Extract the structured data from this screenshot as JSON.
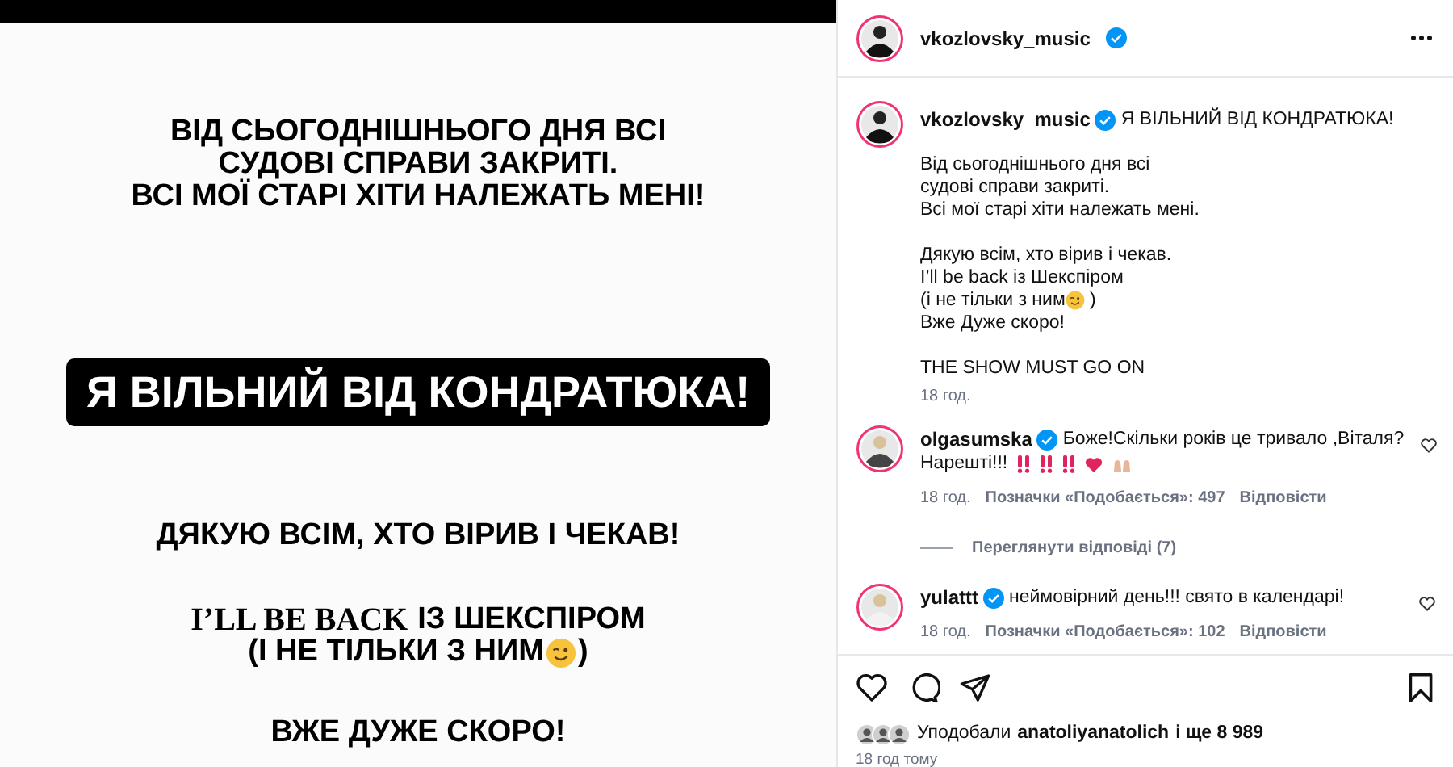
{
  "post_image": {
    "blocks": [
      {
        "kind": "text",
        "lines": [
          {
            "text": "ВІД СЬОГОДНІШНЬОГО ДНЯ ВСІ"
          },
          {
            "text": "СУДОВІ СПРАВИ ЗАКРИТІ."
          },
          {
            "text": "ВСІ МОЇ СТАРІ ХІТИ НАЛЕЖАТЬ МЕНІ!"
          }
        ]
      },
      {
        "kind": "banner",
        "lines": [
          {
            "text": "Я ВІЛЬНИЙ ВІД КОНДРАТЮКА!"
          }
        ]
      },
      {
        "kind": "text",
        "lines": [
          {
            "text": "ДЯКУЮ ВСІМ, ХТО ВІРИВ І ЧЕКАВ!"
          }
        ]
      },
      {
        "kind": "text",
        "lines": [
          {
            "serif": "I’LL BE BACK",
            "text": "ІЗ ШЕКСПІРОМ"
          },
          {
            "text": "(І НЕ ТІЛЬКИ З НИМ",
            "wink": true,
            "tail": ")"
          }
        ]
      },
      {
        "kind": "text",
        "lines": [
          {
            "text": "ВЖЕ ДУЖЕ СКОРО!"
          }
        ]
      }
    ]
  },
  "header": {
    "username": "vkozlovsky_music",
    "verified": true
  },
  "caption": {
    "username": "vkozlovsky_music",
    "verified": true,
    "title": "Я ВІЛЬНИЙ ВІД КОНДРАТЮКА!",
    "paragraphs": [
      [
        {
          "text": "Від сьогоднішнього дня всі"
        },
        {
          "text": "судові справи закриті."
        },
        {
          "text": "Всі мої старі хіти належать мені."
        }
      ],
      [
        {
          "text": "Дякую всім, хто вірив і чекав."
        },
        {
          "text": "I’ll be back із Шекспіром"
        },
        {
          "text": "(і не тільки з ним",
          "wink": true,
          "tail": " )"
        },
        {
          "text": "Вже Дуже скоро!"
        }
      ],
      [
        {
          "text": "THE SHOW MUST GO ON"
        }
      ]
    ],
    "time": "18 год."
  },
  "comments": [
    {
      "username": "olgasumska",
      "verified": true,
      "text": "Боже!Скільки років це тривало ,Віталя?",
      "text2": "Нарешті!!!",
      "emoji_row": true,
      "time": "18 год.",
      "likes": "Позначки «Подобається»: 497",
      "reply": "Відповісти",
      "view_replies": "Переглянути відповіді (7)"
    },
    {
      "username": "yulattt",
      "verified": true,
      "text": "неймовірний день!!! свято в календарі!",
      "time": "18 год.",
      "likes": "Позначки «Подобається»: 102",
      "reply": "Відповісти"
    }
  ],
  "likes": {
    "prefix": "Уподобали",
    "user": "anatoliyanatolich",
    "suffix": "і ще 8 989"
  },
  "posted": "18 год тому"
}
